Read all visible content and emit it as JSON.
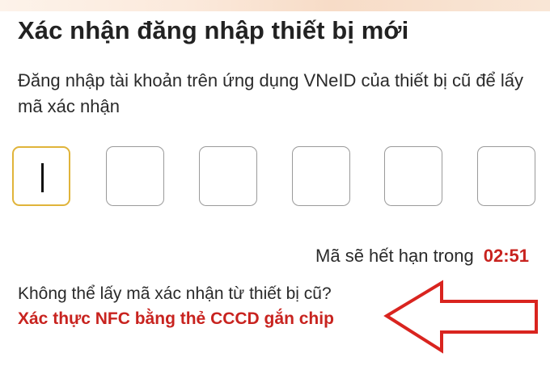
{
  "page": {
    "title": "Xác nhận đăng nhập thiết bị mới",
    "subtitle": "Đăng nhập tài khoản trên ứng dụng VNeID của thiết bị cũ để lấy mã xác nhận"
  },
  "otp": {
    "length": 6,
    "values": [
      "",
      "",
      "",
      "",
      "",
      ""
    ],
    "active_index": 0
  },
  "timer": {
    "label": "Mã sẽ hết hạn trong",
    "value": "02:51"
  },
  "fallback": {
    "question": "Không thể lấy mã xác nhận từ thiết bị cũ?",
    "link_label": "Xác thực NFC bằng thẻ CCCD gắn chip"
  },
  "colors": {
    "accent_red": "#c8231f",
    "active_border": "#e0b43a",
    "box_border": "#9a9a9a"
  },
  "icons": {
    "annotation_arrow": "left-arrow-outline"
  }
}
